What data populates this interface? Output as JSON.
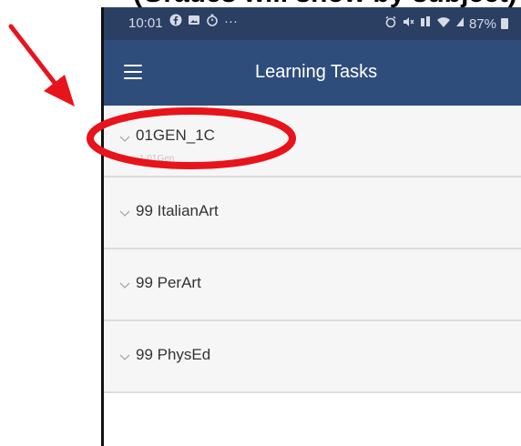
{
  "caption": "(Grades will show by subject)",
  "status_bar": {
    "time": "10:01",
    "battery": "87%",
    "more": "···"
  },
  "app_bar": {
    "title": "Learning Tasks"
  },
  "tasks": [
    {
      "title": "01GEN_1C",
      "subtitle": "1.01Gen"
    },
    {
      "title": "99 ItalianArt"
    },
    {
      "title": "99 PerArt"
    },
    {
      "title": "99 PhysEd"
    }
  ],
  "colors": {
    "status_bar": "#2a3f62",
    "app_bar": "#2e4d7b",
    "annotation": "#e8131b"
  }
}
